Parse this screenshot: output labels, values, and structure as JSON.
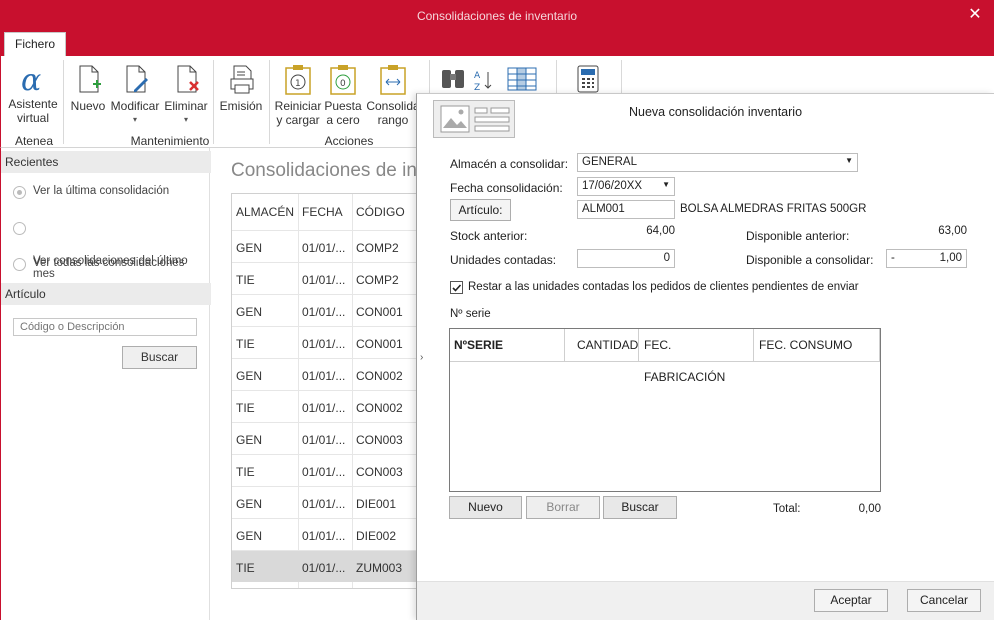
{
  "window": {
    "title": "Consolidaciones de inventario"
  },
  "tabs": [
    {
      "label": "Fichero"
    }
  ],
  "ribbon": {
    "buttons": {
      "asistente": "Asistente\nvirtual",
      "nuevo": "Nuevo",
      "modificar": "Modificar",
      "eliminar": "Eliminar",
      "emision": "Emisión",
      "reiniciar": "Reiniciar\ny cargar",
      "puesta": "Puesta\na cero",
      "consolida": "Consolida\nrango"
    },
    "groups": {
      "atenea": "Atenea",
      "mantenimiento": "Mantenimiento",
      "acciones": "Acciones"
    }
  },
  "left": {
    "recientes_title": "Recientes",
    "options": [
      "Ver la última consolidación",
      "Ver consolidaciones del último\nmes",
      "Ver todas las consolidaciones"
    ],
    "articulo_title": "Artículo",
    "search_placeholder": "Código o Descripción",
    "search_button": "Buscar"
  },
  "main": {
    "heading": "Consolidaciones de inventario",
    "columns": [
      "ALMACÉN",
      "FECHA",
      "CÓDIGO"
    ],
    "rows": [
      {
        "almacen": "GEN",
        "fecha": "01/01/...",
        "codigo": "COMP2"
      },
      {
        "almacen": "TIE",
        "fecha": "01/01/...",
        "codigo": "COMP2"
      },
      {
        "almacen": "GEN",
        "fecha": "01/01/...",
        "codigo": "CON001"
      },
      {
        "almacen": "TIE",
        "fecha": "01/01/...",
        "codigo": "CON001"
      },
      {
        "almacen": "GEN",
        "fecha": "01/01/...",
        "codigo": "CON002"
      },
      {
        "almacen": "TIE",
        "fecha": "01/01/...",
        "codigo": "CON002"
      },
      {
        "almacen": "GEN",
        "fecha": "01/01/...",
        "codigo": "CON003"
      },
      {
        "almacen": "TIE",
        "fecha": "01/01/...",
        "codigo": "CON003"
      },
      {
        "almacen": "GEN",
        "fecha": "01/01/...",
        "codigo": "DIE001"
      },
      {
        "almacen": "GEN",
        "fecha": "01/01/...",
        "codigo": "DIE002"
      },
      {
        "almacen": "TIE",
        "fecha": "01/01/...",
        "codigo": "ZUM003",
        "selected": true
      }
    ]
  },
  "dialog": {
    "title": "Nueva consolidación inventario",
    "almacen_label": "Almacén a consolidar:",
    "almacen_value": "GENERAL",
    "fecha_label": "Fecha consolidación:",
    "fecha_value": "17/06/20XX",
    "articulo_button": "Artículo:",
    "articulo_code": "ALM001",
    "articulo_desc": "BOLSA ALMEDRAS FRITAS 500GR",
    "stock_label": "Stock anterior:",
    "stock_value": "64,00",
    "disp_ant_label": "Disponible anterior:",
    "disp_ant_value": "63,00",
    "unidades_label": "Unidades contadas:",
    "unidades_value": "0",
    "disp_cons_label": "Disponible a consolidar:",
    "disp_cons_sign": "-",
    "disp_cons_value": "1,00",
    "restar_label": "Restar a las unidades contadas los pedidos de clientes pendientes de enviar",
    "restar_checked": true,
    "serie_label": "Nº serie",
    "serie_columns": [
      "NºSERIE",
      "CANTIDAD",
      "FEC. FABRICACIÓN",
      "FEC. CONSUMO"
    ],
    "btn_nuevo": "Nuevo",
    "btn_borrar": "Borrar",
    "btn_buscar": "Buscar",
    "total_label": "Total:",
    "total_value": "0,00",
    "aceptar": "Aceptar",
    "cancelar": "Cancelar"
  },
  "colors": {
    "brand": "#c8102e",
    "accent_icon": "#2b6cb0",
    "green_plus": "#2e9e3e",
    "red_x": "#d93030",
    "gold": "#c9a227"
  }
}
